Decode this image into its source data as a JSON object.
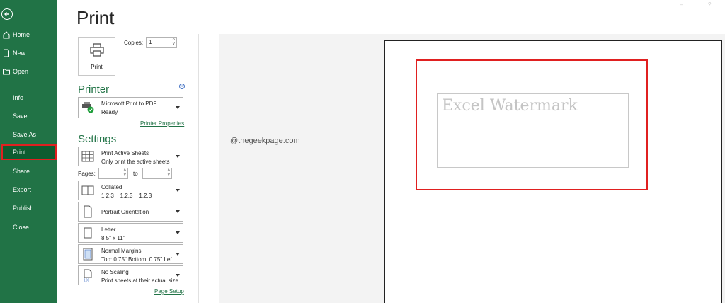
{
  "title": "Print",
  "sidebar": {
    "items": [
      {
        "label": "Home",
        "icon": "home-icon"
      },
      {
        "label": "New",
        "icon": "new-doc-icon"
      },
      {
        "label": "Open",
        "icon": "folder-icon"
      },
      {
        "label": "Info"
      },
      {
        "label": "Save"
      },
      {
        "label": "Save As"
      },
      {
        "label": "Print"
      },
      {
        "label": "Share"
      },
      {
        "label": "Export"
      },
      {
        "label": "Publish"
      },
      {
        "label": "Close"
      }
    ],
    "active": "Print"
  },
  "print": {
    "button_label": "Print",
    "copies_label": "Copies:",
    "copies_value": "1"
  },
  "printer": {
    "section_title": "Printer",
    "name": "Microsoft Print to PDF",
    "status": "Ready",
    "properties_link": "Printer Properties"
  },
  "settings": {
    "section_title": "Settings",
    "scope": {
      "title": "Print Active Sheets",
      "sub": "Only print the active sheets"
    },
    "pages_label": "Pages:",
    "to_label": "to",
    "collation": {
      "title": "Collated",
      "sub": "1,2,3    1,2,3    1,2,3"
    },
    "orientation": {
      "title": "Portrait Orientation"
    },
    "paper": {
      "title": "Letter",
      "sub": "8.5\" x 11\""
    },
    "margins": {
      "title": "Normal Margins",
      "sub": "Top: 0.75\" Bottom: 0.75\" Lef..."
    },
    "scaling": {
      "title": "No Scaling",
      "sub": "Print sheets at their actual size"
    },
    "page_setup_link": "Page Setup"
  },
  "preview": {
    "site_watermark": "@thegeekpage.com",
    "watermark_text": "Excel Watermark"
  },
  "colors": {
    "accent": "#217346",
    "highlight": "#e02020"
  }
}
